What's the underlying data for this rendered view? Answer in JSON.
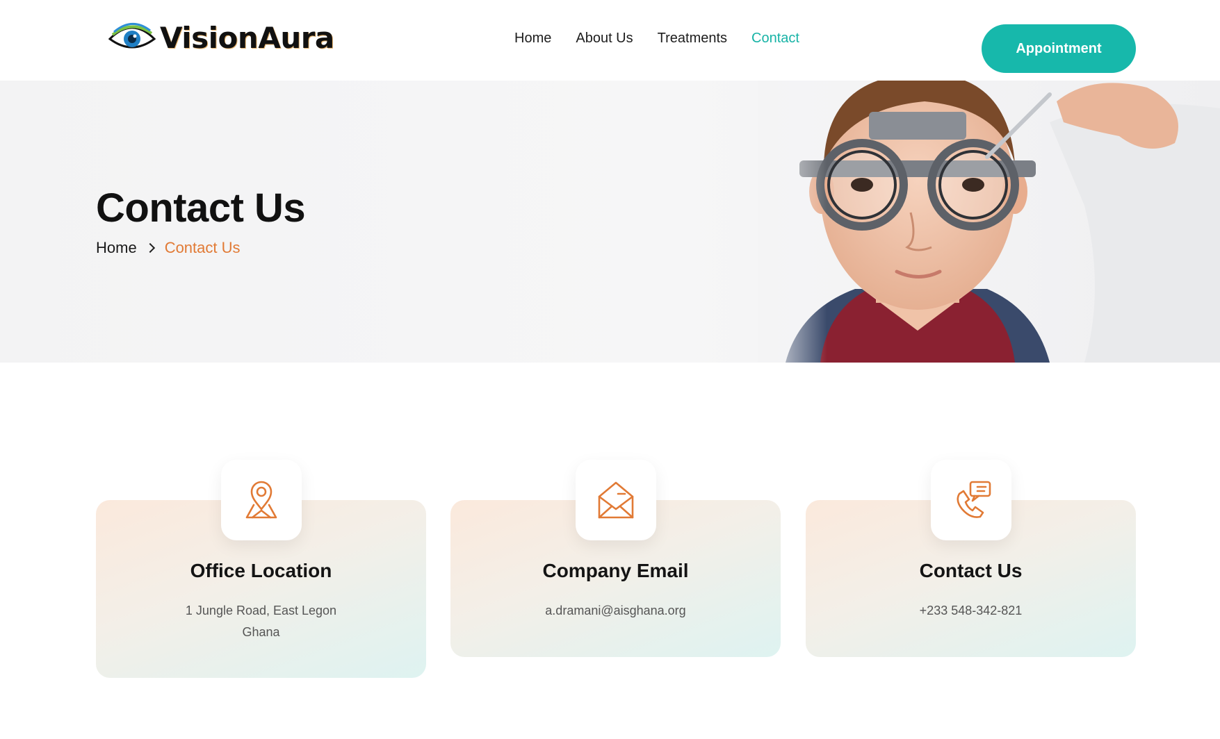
{
  "brand": {
    "name": "VisionAura",
    "logo_icon": "eye-logo-icon"
  },
  "nav": {
    "items": [
      {
        "label": "Home",
        "active": false
      },
      {
        "label": "About Us",
        "active": false
      },
      {
        "label": "Treatments",
        "active": false
      },
      {
        "label": "Contact",
        "active": true
      }
    ],
    "cta_label": "Appointment"
  },
  "hero": {
    "title": "Contact Us",
    "breadcrumb": {
      "home": "Home",
      "current": "Contact Us"
    }
  },
  "cards": [
    {
      "icon": "location-pin-icon",
      "title": "Office Location",
      "lines": [
        "1 Jungle Road, East Legon",
        "Ghana"
      ]
    },
    {
      "icon": "envelope-icon",
      "title": "Company Email",
      "lines": [
        "a.dramani@aisghana.org"
      ]
    },
    {
      "icon": "phone-chat-icon",
      "title": "Contact Us",
      "lines": [
        "+233 548-342-821"
      ]
    }
  ],
  "colors": {
    "accent_teal": "#17b8ab",
    "accent_orange": "#e17a35",
    "text_dark": "#111111"
  }
}
